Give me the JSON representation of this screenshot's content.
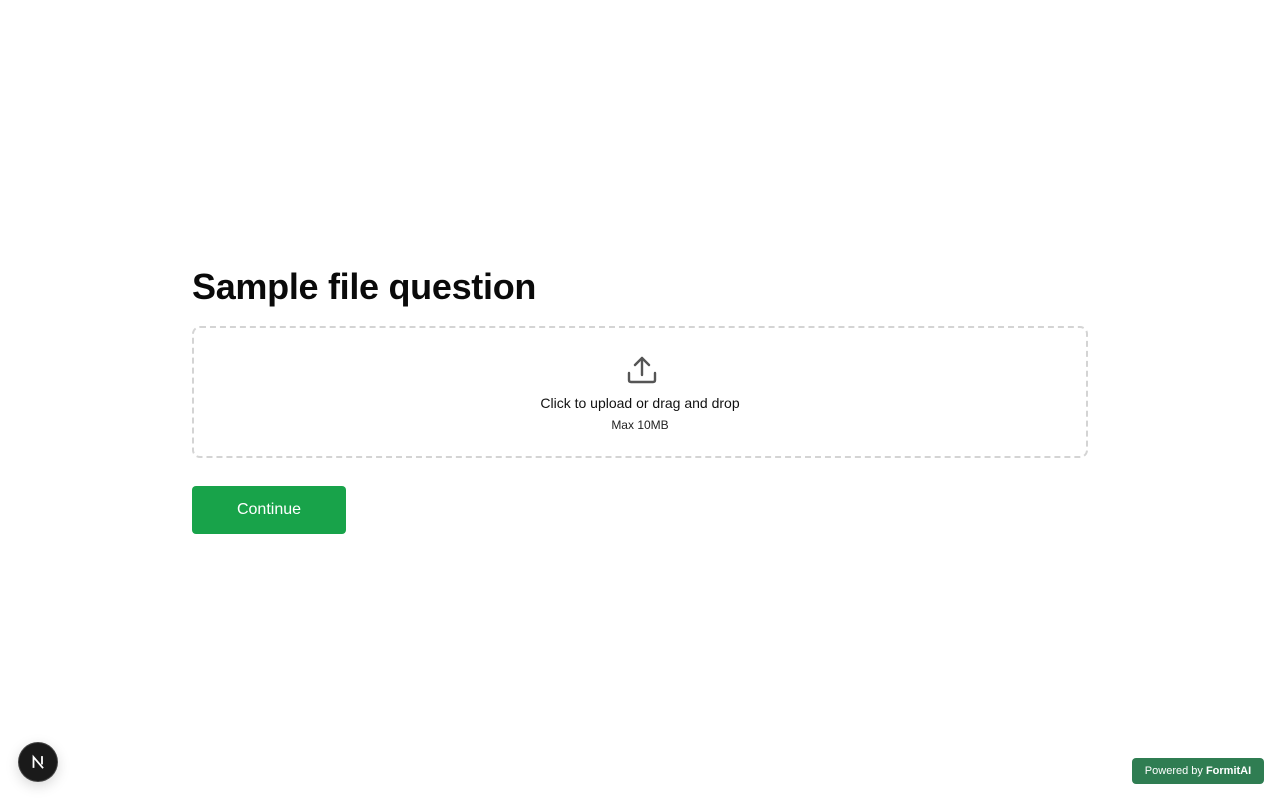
{
  "question": {
    "title": "Sample file question"
  },
  "upload": {
    "icon": "upload-icon",
    "prompt": "Click to upload or drag and drop",
    "hint": "Max 10MB"
  },
  "actions": {
    "continue_label": "Continue",
    "accent_color": "#18a34a"
  },
  "dev_badge": {
    "icon": "nextjs-logo-icon",
    "letter": "N"
  },
  "footer": {
    "powered_prefix": "Powered by",
    "powered_brand": "FormitAI",
    "badge_color": "#2f7d52"
  }
}
